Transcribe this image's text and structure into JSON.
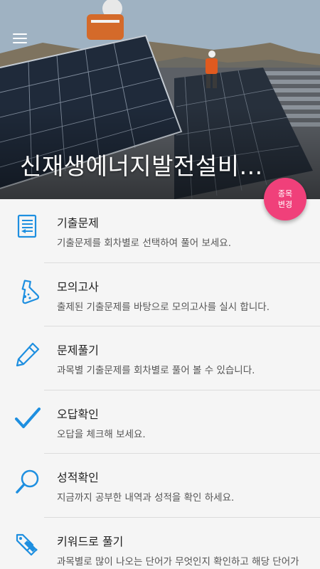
{
  "header": {
    "title": "신재생에너지발전설비...",
    "menu_icon": "hamburger-menu-icon"
  },
  "fab": {
    "line1": "종목",
    "line2": "변경",
    "color": "#f0407a"
  },
  "accent_color": "#1e8fe0",
  "items": [
    {
      "title": "기출문제",
      "desc": "기출문제를 회차별로 선택하여 풀어 보세요.",
      "icon": "document-list-icon"
    },
    {
      "title": "모의고사",
      "desc": "출제된 기출문제를 바탕으로 모의고사를 실시 합니다.",
      "icon": "flask-icon"
    },
    {
      "title": "문제풀기",
      "desc": "과목별 기출문제를 회차별로 풀어 볼 수 있습니다.",
      "icon": "pencil-icon"
    },
    {
      "title": "오답확인",
      "desc": "오답을 체크해 보세요.",
      "icon": "checkmark-icon"
    },
    {
      "title": "성적확인",
      "desc": "지금까지 공부한 내역과 성적을 확인 하세요.",
      "icon": "magnifier-icon"
    },
    {
      "title": "키워드로 풀기",
      "desc": "과목별로 많이 나오는 단어가 무엇인지 확인하고 해당 단어가 나오는 문제들을 풀어 보세요.",
      "icon": "tags-icon"
    }
  ]
}
